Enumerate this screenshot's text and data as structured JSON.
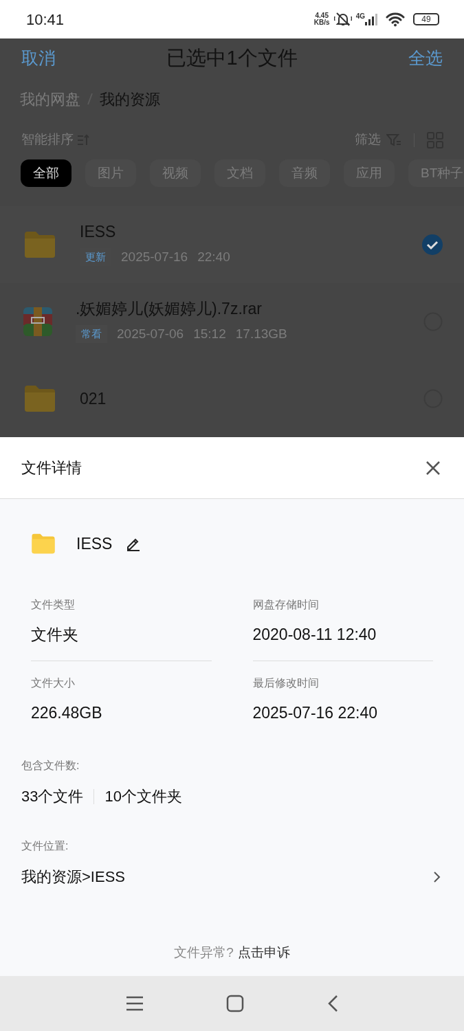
{
  "status_bar": {
    "time": "10:41",
    "net_speed": [
      "4.45",
      "KB/s"
    ],
    "network": "4G",
    "battery": "49"
  },
  "header": {
    "cancel": "取消",
    "title": "已选中1个文件",
    "select_all": "全选"
  },
  "breadcrumb": [
    {
      "label": "我的网盘",
      "current": false
    },
    {
      "label": "我的资源",
      "current": true
    }
  ],
  "sort": {
    "label": "智能排序",
    "filter": "筛选"
  },
  "categories": [
    {
      "label": "全部",
      "selected": true
    },
    {
      "label": "图片",
      "selected": false
    },
    {
      "label": "视频",
      "selected": false
    },
    {
      "label": "文档",
      "selected": false
    },
    {
      "label": "音频",
      "selected": false
    },
    {
      "label": "应用",
      "selected": false
    },
    {
      "label": "BT种子",
      "selected": false
    }
  ],
  "files": [
    {
      "kind": "folder",
      "name": "IESS",
      "tag": "更新",
      "meta": [
        "2025-07-16",
        "22:40"
      ],
      "selected": true
    },
    {
      "kind": "archive",
      "name": ".妖媚婷儿(妖媚婷儿).7z.rar",
      "tag": "常看",
      "meta": [
        "2025-07-06",
        "15:12",
        "17.13GB"
      ],
      "selected": false
    },
    {
      "kind": "folder",
      "name": "021",
      "selected": false
    }
  ],
  "sheet": {
    "title": "文件详情",
    "file": {
      "kind": "folder",
      "name": "IESS"
    },
    "details": [
      {
        "label": "文件类型",
        "value": "文件夹"
      },
      {
        "label": "网盘存储时间",
        "value": "2020-08-11 12:40"
      },
      {
        "label": "文件大小",
        "value": "226.48GB"
      },
      {
        "label": "最后修改时间",
        "value": "2025-07-16 22:40"
      }
    ],
    "counts_label": "包含文件数:",
    "counts": [
      "33个文件",
      "10个文件夹"
    ],
    "location_label": "文件位置:",
    "location": "我的资源>IESS",
    "footer_text": "文件异常?",
    "footer_link": "点击申诉"
  }
}
